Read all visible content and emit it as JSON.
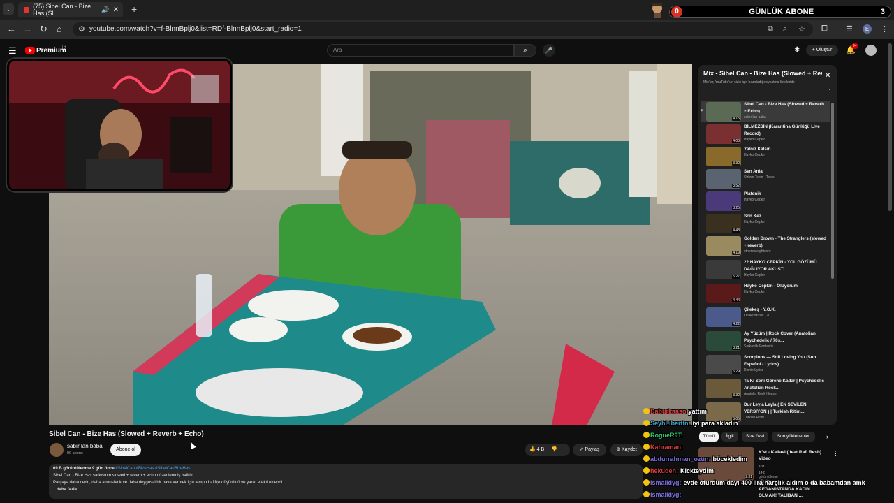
{
  "browser": {
    "tab_title": "(75) Sibel Can - Bize Has (Sl",
    "url": "youtube.com/watch?v=f-BlnnBplj0&list=RDf-BlnnBplj0&start_radio=1",
    "profile_initial": "E"
  },
  "overlay": {
    "sub_counter_label": "GÜNLÜK ABONE",
    "sub_counter_left": "0",
    "sub_counter_right": "3"
  },
  "header": {
    "brand": "Premium",
    "brand_country": "TR",
    "search_placeholder": "Ara",
    "create_label": "Oluştur",
    "notifications_badge": "9+"
  },
  "video": {
    "title": "Sibel Can - Bize Has (Slowed + Reverb + Echo)",
    "channel": "sabır lan baba",
    "subscribers": "90 abone",
    "subscribe_label": "Abone ol",
    "likes": "4 B",
    "share_label": "Paylaş",
    "save_label": "Kaydet",
    "desc_stats": "69 B görüntülenme  9 gün önce",
    "desc_tags": "#SibelCan #BizeHas #SibelCanBizeHas",
    "desc_line1": "Sibel Can - Bize Has şarkısının slowed + reverb + echo düzenlenmiş halidir.",
    "desc_line2": "Parçaya daha derin, daha atmosferik ve daha duygusal bir hava vermek için tempo hafifçe düşürüldü ve yankı efekti eklendi.",
    "desc_more": "...daha fazla"
  },
  "playlist": {
    "title": "Mix - Sibel Can - Bize Has (Slowed + Reverb + Echo)",
    "subtitle": "Mix'ler, YouTube'un sizin için hazırladığı oynatma listeleridir",
    "items": [
      {
        "title": "Sibel Can - Bize Has (Slowed + Reverb + Echo)",
        "channel": "sabır lan baba",
        "duration": "4:15",
        "color": "#5a6a55"
      },
      {
        "title": "BİLMEZSİN (Karantina Günlüğü Live Record)",
        "channel": "Hayko Cepkin",
        "duration": "4:08",
        "color": "#7a3030"
      },
      {
        "title": "Yalnız Kalsın",
        "channel": "Hayko Cepkin",
        "duration": "3:30",
        "color": "#8a6a2a"
      },
      {
        "title": "Sen Anla",
        "channel": "Özlem Tekin - Topic",
        "duration": "3:52",
        "color": "#5a6470"
      },
      {
        "title": "Platonik",
        "channel": "Hayko Cepkin",
        "duration": "3:25",
        "color": "#4a3a7a"
      },
      {
        "title": "Son Kez",
        "channel": "Hayko Cepkin",
        "duration": "4:48",
        "color": "#3a3020"
      },
      {
        "title": "Golden Brown - The Stranglers (slowed + reverb)",
        "channel": "etherealeightcore",
        "duration": "4:19",
        "color": "#9a8a60"
      },
      {
        "title": "22 HAYKO CEPKİN - YOL GÖZÜMÜ DAĞLIYOR AKUSTİ...",
        "channel": "Hayko Cepkin",
        "duration": "5:27",
        "color": "#3a3a3a"
      },
      {
        "title": "Hayko Cepkin - Ölüyorum",
        "channel": "Hayko Cepkin",
        "duration": "4:44",
        "color": "#5a1a1a"
      },
      {
        "title": "Çilekeş - Y.O.K.",
        "channel": "On Air Music Co.",
        "duration": "4:22",
        "color": "#4a5a8a"
      },
      {
        "title": "Ay Yüzüm | Rock Cover (Anatolian Psychedelic / 70s...",
        "channel": "Sarkastik Fantastik",
        "duration": "3:21",
        "color": "#2a4a3a"
      },
      {
        "title": "Scorpions — Still Loving You (Sub. Español / Lyrics)",
        "channel": "Richie Lyrics",
        "duration": "6:29",
        "color": "#4a4a4a"
      },
      {
        "title": "Ta Ki Seni Görene Kadar | Psychedelic Anatolian Rock...",
        "channel": "Anatolia Rock House",
        "duration": "3:32",
        "color": "#6a5a3a"
      },
      {
        "title": "Dur Leyla Leyla ( EN SEVİLEN VERSİYON ) | Turkish Ritim...",
        "channel": "Turkish Ritim",
        "duration": "5:05",
        "color": "#7a6a4a"
      }
    ]
  },
  "chips": [
    "Tümü",
    "İlgili",
    "Size özel",
    "Son yüklenenler"
  ],
  "recommendation": {
    "title": "K'st - Kallavi ( feat Rafi Resh) Video",
    "channel": "K'st",
    "meta": "14 B görüntüleme • 6 gün önce",
    "duration": "2:31",
    "title2": "AFGANİSTANDA KADIN OLMAK! TALİBAN ..."
  },
  "chat": [
    {
      "user": "Daburkaaso",
      "msg": "yattım",
      "color": "#d63b3b"
    },
    {
      "user": "SeyhLibertin:",
      "msg": "iyi para akladın",
      "color": "#3aa6d0"
    },
    {
      "user": "RogueR9T:",
      "msg": "",
      "color": "#2ecc71"
    },
    {
      "user": "Kahraman:",
      "msg": "",
      "color": "#d63b3b"
    },
    {
      "user": "abdurrahman_ozun:",
      "msg": "böcekledim",
      "color": "#7b6fe0"
    },
    {
      "user": "hekuden:",
      "msg": "Kickteydim",
      "color": "#d63b3b"
    },
    {
      "user": "ismaildyg:",
      "msg": "evde oturdum dayı 400 lira harçlık aldım o da babamdan amk",
      "color": "#7b6fe0"
    },
    {
      "user": "ismaildyg:",
      "msg": "",
      "color": "#7b6fe0"
    }
  ],
  "colors": {
    "accent_red": "#ff0000",
    "link_blue": "#3ea6ff",
    "panel_bg": "#212121"
  }
}
